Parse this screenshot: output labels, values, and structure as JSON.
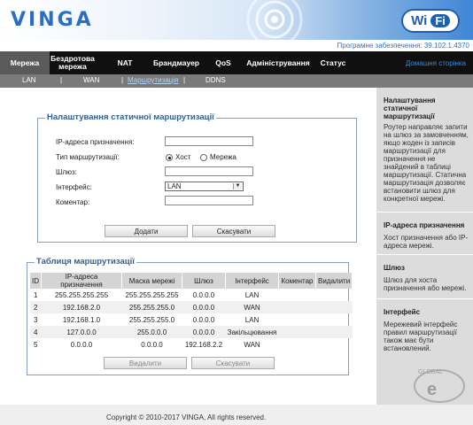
{
  "header": {
    "logo": "VINGA",
    "wifi_wi": "Wi",
    "wifi_fi": "Fi"
  },
  "firmware": "Програмне забезпечення: 39.102.1.4370",
  "nav": {
    "items": [
      "Мережа",
      "Бездротова мережа",
      "NAT",
      "Брандмауер",
      "QoS",
      "Адміністрування",
      "Статус"
    ],
    "home": "Домашня сторінка"
  },
  "subnav": {
    "items": [
      "LAN",
      "WAN",
      "Маршрутизація",
      "DDNS"
    ],
    "sep": "|"
  },
  "static_form": {
    "legend": "Налаштування статичної маршрутизації",
    "ip_label": "IP-адреса призначення:",
    "ip_value": "",
    "type_label": "Тип маршрутизації:",
    "type_host": "Хост",
    "type_net": "Мережа",
    "gateway_label": "Шлюз:",
    "gateway_value": "",
    "iface_label": "Інтерфейс:",
    "iface_value": "LAN",
    "comment_label": "Коментар:",
    "comment_value": "",
    "add_button": "Додати",
    "cancel_button": "Скасувати"
  },
  "route_table": {
    "legend": "Таблиця маршрутизації",
    "headers": [
      "ID",
      "IP-адреса призначення",
      "Маска мережі",
      "Шлюз",
      "Інтерфейс",
      "Коментар",
      "Видалити"
    ],
    "rows": [
      [
        "1",
        "255.255.255.255",
        "255.255.255.255",
        "0.0.0.0",
        "LAN",
        "",
        ""
      ],
      [
        "2",
        "192.168.2.0",
        "255.255.255.0",
        "0.0.0.0",
        "WAN",
        "",
        ""
      ],
      [
        "3",
        "192.168.1.0",
        "255.255.255.0",
        "0.0.0.0",
        "LAN",
        "",
        ""
      ],
      [
        "4",
        "127.0.0.0",
        "255.0.0.0",
        "0.0.0.0",
        "Закільцювання",
        "",
        ""
      ],
      [
        "5",
        "0.0.0.0",
        "0.0.0.0",
        "192.168.2.2",
        "WAN",
        "",
        ""
      ]
    ],
    "delete_button": "Видалити",
    "cancel_button": "Скасувати"
  },
  "help": {
    "sections": [
      {
        "title": "Налаштування статичної маршрутизації",
        "text": "Роутер направляє запити на шлюз за замовченням, якщо жоден із записів маршрутизації для призначення не знайдений в таблиці маршрутизації. Статична маршрутизація дозволяє встановити шлюз для конкретної мережі."
      },
      {
        "title": "IP-адреса призначення",
        "text": "Хост призначення або IP-адреса мережі."
      },
      {
        "title": "Шлюз",
        "text": "Шлюз для хоста призначення або мережі."
      },
      {
        "title": "Інтерфейс",
        "text": "Мережевий інтерфейс правил маршрутизації також має бути встановлений."
      }
    ]
  },
  "footer": {
    "copyright": "Copyright © 2010-2017 VINGA, All rights reserved."
  },
  "watermark": {
    "word": "GLOBAL"
  },
  "colors": {
    "accent": "#2f73c3",
    "nav_bg": "#101010",
    "subnav_bg": "#7a7a7a",
    "help_bg": "#dcdcdc"
  }
}
